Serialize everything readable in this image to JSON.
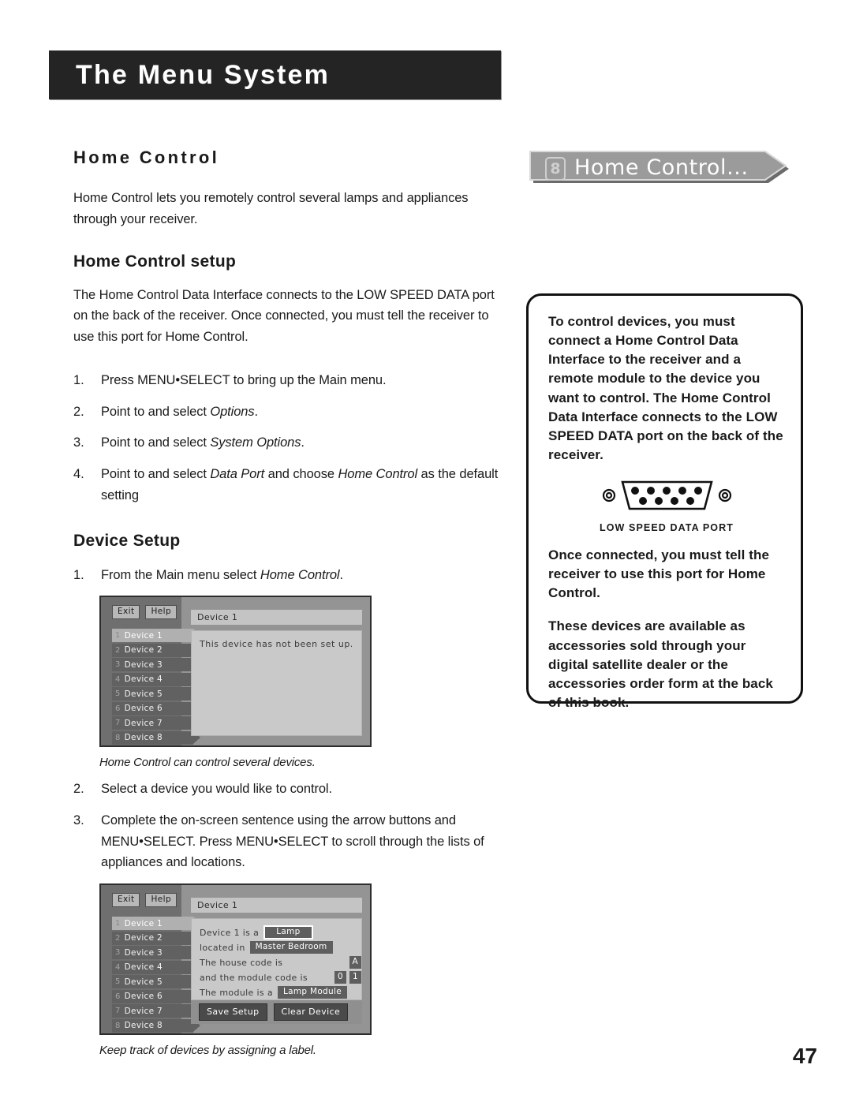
{
  "chapter": {
    "banner_title": "The Menu System"
  },
  "page": {
    "number": "47"
  },
  "left": {
    "section_title": "Home Control",
    "intro": "Home Control lets you remotely control several lamps and appliances through your receiver.",
    "setup_title": "Home Control setup",
    "setup_intro": "The Home Control Data Interface connects to the LOW SPEED DATA port on the back of the receiver. Once connected, you must tell the receiver to use this port for Home Control.",
    "setup_steps": [
      {
        "num": "1.",
        "text": "Press MENU•SELECT to bring up the Main menu."
      },
      {
        "num": "2.",
        "pre": "Point to and select ",
        "em": "Options",
        "post": "."
      },
      {
        "num": "3.",
        "pre": "Point to and select ",
        "em": "System Options",
        "post": "."
      },
      {
        "num": "4.",
        "pre": "Point to and select ",
        "em": "Data Port",
        "mid": " and choose ",
        "em2": "Home Control",
        "post": " as the default setting"
      }
    ],
    "device_title": "Device Setup",
    "device_steps": [
      {
        "num": "1.",
        "pre": "From the Main menu select ",
        "em": "Home Control",
        "post": "."
      },
      {
        "num": "2.",
        "text": "Select a device you would like to control."
      },
      {
        "num": "3.",
        "text": "Complete the on-screen sentence using the arrow buttons and MENU•SELECT. Press MENU•SELECT to scroll through the lists of appliances and locations."
      }
    ],
    "caption_1": "Home Control can control several devices.",
    "caption_2": "Keep track of devices by assigning a label."
  },
  "screenshot1": {
    "exit_label": "Exit",
    "help_label": "Help",
    "devices": [
      {
        "num": "1",
        "label": "Device 1",
        "selected": true
      },
      {
        "num": "2",
        "label": "Device 2",
        "selected": false
      },
      {
        "num": "3",
        "label": "Device 3",
        "selected": false
      },
      {
        "num": "4",
        "label": "Device 4",
        "selected": false
      },
      {
        "num": "5",
        "label": "Device 5",
        "selected": false
      },
      {
        "num": "6",
        "label": "Device 6",
        "selected": false
      },
      {
        "num": "7",
        "label": "Device 7",
        "selected": false
      },
      {
        "num": "8",
        "label": "Device 8",
        "selected": false
      }
    ],
    "title_bar": "Device 1",
    "message": "This device has not been set up."
  },
  "screenshot2": {
    "exit_label": "Exit",
    "help_label": "Help",
    "devices": [
      {
        "num": "1",
        "label": "Device 1",
        "selected": true
      },
      {
        "num": "2",
        "label": "Device 2",
        "selected": false
      },
      {
        "num": "3",
        "label": "Device 3",
        "selected": false
      },
      {
        "num": "4",
        "label": "Device 4",
        "selected": false
      },
      {
        "num": "5",
        "label": "Device 5",
        "selected": false
      },
      {
        "num": "6",
        "label": "Device 6",
        "selected": false
      },
      {
        "num": "7",
        "label": "Device 7",
        "selected": false
      },
      {
        "num": "8",
        "label": "Device 8",
        "selected": false
      }
    ],
    "title_bar": "Device 1",
    "line1_label": "Device 1 is a",
    "line1_value": "Lamp",
    "line2_label": "located in",
    "line2_value": "Master Bedroom",
    "line3_label": "The house code is",
    "line3_value": "A",
    "line4_label": "and the module code is",
    "line4_value_a": "0",
    "line4_value_b": "1",
    "line5_label": "The module is a",
    "line5_value": "Lamp Module",
    "save_label": "Save Setup",
    "clear_label": "Clear Device"
  },
  "menu_banner": {
    "number": "8",
    "label": "Home Control..."
  },
  "sidebar": {
    "para1": "To control devices, you must connect a Home Control Data Interface to the receiver and a remote module to the device you want to control. The Home Control Data Interface connects to the LOW SPEED DATA port on the back of the receiver.",
    "connector_label": "LOW SPEED DATA PORT",
    "para2": "Once connected, you must tell the receiver to use this port for Home Control.",
    "para3": "These devices are available as accessories sold through your digital satellite dealer or the accessories order form at the back of this book."
  },
  "colors": {
    "banner_bg": "#242424",
    "ink": "#1a1a1a",
    "tv_bg": "#6f6f6f",
    "tv_panel": "#c9c9c9"
  }
}
